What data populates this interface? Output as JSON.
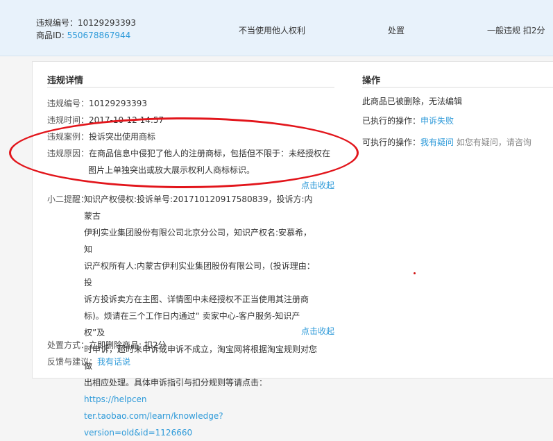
{
  "header": {
    "violation_id_label": "违规编号：",
    "violation_id": "10129293393",
    "product_id_label": "商品ID: ",
    "product_id": "550678867944",
    "reason": "不当使用他人权利",
    "action": "处置",
    "penalty": "一般违规 扣2分"
  },
  "details": {
    "title": "违规详情",
    "id_label": "违规编号：",
    "id_value": "10129293393",
    "time_label": "违规时间：",
    "time_value": "2017-10-12 14:57",
    "case_label": "违规案例：",
    "case_value": "投诉突出使用商标",
    "reason_label": "违规原因：",
    "reason_line1": "在商品信息中侵犯了他人的注册商标，包括但不限于：未经授权在",
    "reason_line2": "图片上单独突出或放大展示权利人商标标识。",
    "collapse1": "点击收起",
    "tip_label": "小二提醒：",
    "tip_lines": [
      "知识产权侵权:投诉单号:201710120917580839，投诉方:内蒙古",
      "伊利实业集团股份有限公司北京分公司，知识产权名:安慕希，知",
      "识产权所有人:内蒙古伊利实业集团股份有限公司，(投诉理由：投",
      "诉方投诉卖方在主图、详情图中未经授权不正当使用其注册商",
      "标)。烦请在三个工作日内通过“ 卖家中心-客户服务-知识产权”及",
      "时申诉，超时未申诉或申诉不成立，淘宝网将根据淘宝规则对您做",
      "出相应处理。具体申诉指引与扣分规则等请点击："
    ],
    "tip_link_part1": "https://helpcen",
    "tip_link_part2": "ter.taobao.com/learn/knowledge?version=old&id=1126660",
    "collapse2": "点击收起",
    "handling_label": "处置方式：",
    "handling_value": "立即删除商品; 扣2分",
    "feedback_label": "反馈与建议：",
    "feedback_link": "我有话说"
  },
  "operations": {
    "title": "操作",
    "deleted_note": "此商品已被删除，无法编辑",
    "executed_label": "已执行的操作：",
    "executed_link": "申诉失败",
    "available_label": "可执行的操作：",
    "available_link": "我有疑问",
    "available_hint": " 如您有疑问，请咨询"
  },
  "colors": {
    "accent_link": "#2e9ad9",
    "annotation_red": "#e2151b",
    "header_bg": "#e8f2fb"
  }
}
